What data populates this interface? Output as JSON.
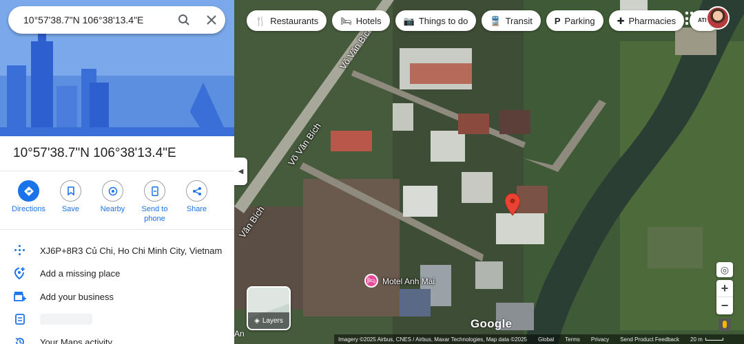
{
  "search": {
    "query": "10°57'38.7\"N 106°38'13.4\"E"
  },
  "place": {
    "title": "10°57'38.7\"N 106°38'13.4\"E"
  },
  "actions": [
    {
      "label": "Directions",
      "icon": "directions-icon"
    },
    {
      "label": "Save",
      "icon": "bookmark-icon"
    },
    {
      "label": "Nearby",
      "icon": "nearby-icon"
    },
    {
      "label": "Send to phone",
      "icon": "send-to-phone-icon"
    },
    {
      "label": "Share",
      "icon": "share-icon"
    }
  ],
  "info": [
    {
      "icon": "plus-code-icon",
      "text": "XJ6P+8R3 Củ Chi, Ho Chi Minh City, Vietnam"
    },
    {
      "icon": "add-place-icon",
      "text": "Add a missing place"
    },
    {
      "icon": "add-business-icon",
      "text": "Add your business"
    },
    {
      "icon": "label-icon",
      "text": ""
    },
    {
      "icon": "history-icon",
      "text": "Your Maps activity"
    }
  ],
  "chips": [
    {
      "label": "Restaurants",
      "icon": "restaurant-icon"
    },
    {
      "label": "Hotels",
      "icon": "hotel-icon"
    },
    {
      "label": "Things to do",
      "icon": "camera-icon"
    },
    {
      "label": "Transit",
      "icon": "transit-icon"
    },
    {
      "label": "Parking",
      "icon": "parking-icon"
    },
    {
      "label": "Pharmacies",
      "icon": "pharmacy-icon"
    },
    {
      "label": "AT",
      "icon": "atm-icon"
    }
  ],
  "map": {
    "road_labels": [
      "Võ Văn Bích",
      "Võ Văn Bích",
      "Văn Bích"
    ],
    "poi": {
      "name": "Motel Anh Mai",
      "icon": "hotel-icon",
      "color": "#e74c9a"
    },
    "pin_color": "#ea4335",
    "layers_label": "Layers",
    "logo": "Google",
    "edge_label": "An",
    "attribution": "Imagery ©2025 Airbus, CNES / Airbus, Maxar Technologies, Map data ©2025",
    "footer_links": [
      "Global",
      "Terms",
      "Privacy",
      "Send Product Feedback"
    ],
    "scale": "20 m"
  },
  "colors": {
    "accent": "#1a73e8",
    "hero_bg": "#76a5e8"
  }
}
